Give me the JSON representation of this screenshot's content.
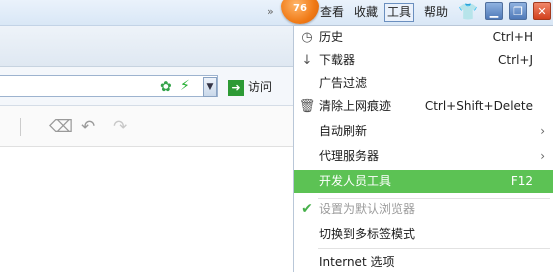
{
  "menubar": {
    "badge": "76",
    "items": [
      "查看",
      "收藏",
      "工具",
      "帮助"
    ],
    "active_index": 2
  },
  "address": {
    "visit_label": "访问"
  },
  "tools_menu": {
    "items": [
      {
        "label": "历史",
        "shortcut": "Ctrl+H",
        "icon": "clock-icon"
      },
      {
        "label": "下载器",
        "shortcut": "Ctrl+J",
        "icon": "download-arrow-icon"
      },
      {
        "label": "广告过滤",
        "shortcut": "",
        "icon": ""
      },
      {
        "label": "清除上网痕迹",
        "shortcut": "Ctrl+Shift+Delete",
        "icon": "trash-icon"
      },
      {
        "label": "自动刷新",
        "shortcut": "",
        "icon": "",
        "submenu": true
      },
      {
        "label": "代理服务器",
        "shortcut": "",
        "icon": "",
        "submenu": true
      },
      {
        "label": "开发人员工具",
        "shortcut": "F12",
        "icon": "",
        "highlighted": true
      },
      {
        "label": "设置为默认浏览器",
        "shortcut": "",
        "icon": "checkmark-icon",
        "disabled": true
      },
      {
        "label": "切换到多标签模式",
        "shortcut": "",
        "icon": ""
      },
      {
        "label": "Internet 选项",
        "shortcut": "",
        "icon": ""
      }
    ]
  },
  "colors": {
    "highlight": "#5cc254",
    "badge": "#f07a16",
    "close_button": "#d2411e"
  }
}
